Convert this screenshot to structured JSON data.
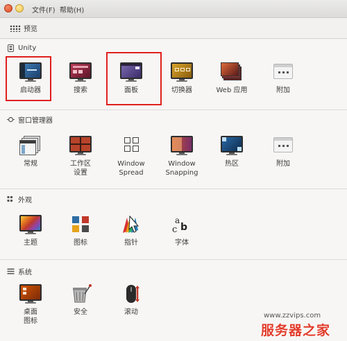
{
  "menubar": {
    "file": "文件(F)",
    "help": "帮助(H)"
  },
  "toolbar": {
    "preview_label": "预览"
  },
  "sections": {
    "unity": {
      "title": "Unity",
      "items": [
        {
          "label": "启动器",
          "icon": "launcher-icon"
        },
        {
          "label": "搜索",
          "icon": "search-icon"
        },
        {
          "label": "面板",
          "icon": "panel-icon"
        },
        {
          "label": "切换器",
          "icon": "switcher-icon"
        },
        {
          "label": "Web 应用",
          "icon": "web-apps-icon"
        },
        {
          "label": "附加",
          "icon": "additional-icon"
        }
      ]
    },
    "window_manager": {
      "title": "窗口管理器",
      "items": [
        {
          "label": "常规",
          "icon": "general-icon"
        },
        {
          "label": "工作区\n设置",
          "icon": "workspace-settings-icon"
        },
        {
          "label": "Window\nSpread",
          "icon": "window-spread-icon"
        },
        {
          "label": "Window\nSnapping",
          "icon": "window-snapping-icon"
        },
        {
          "label": "热区",
          "icon": "hotcorners-icon"
        },
        {
          "label": "附加",
          "icon": "additional-icon"
        }
      ]
    },
    "appearance": {
      "title": "外观",
      "items": [
        {
          "label": "主题",
          "icon": "theme-icon"
        },
        {
          "label": "图标",
          "icon": "icons-icon"
        },
        {
          "label": "指针",
          "icon": "cursor-icon"
        },
        {
          "label": "字体",
          "icon": "fonts-icon"
        }
      ]
    },
    "system": {
      "title": "系统",
      "items": [
        {
          "label": "桌面\n图标",
          "icon": "desktop-icons-icon"
        },
        {
          "label": "安全",
          "icon": "security-icon"
        },
        {
          "label": "滚动",
          "icon": "scrolling-icon"
        }
      ]
    }
  },
  "watermark": {
    "url": "www.zzvips.com",
    "brand": "服务器之家"
  },
  "colors": {
    "highlight": "#e0201e",
    "close_button": "#df4a20",
    "minimize_button": "#f2c54a",
    "brand_red": "#e23c2b"
  }
}
